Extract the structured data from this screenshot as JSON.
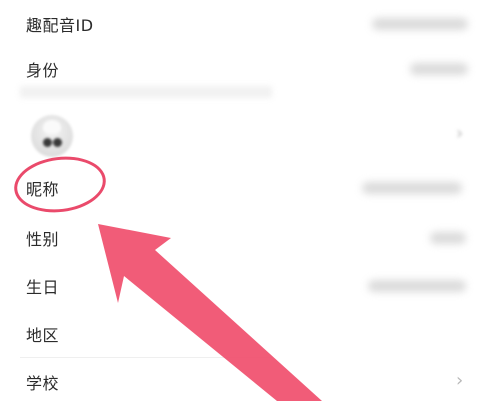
{
  "profile": {
    "qupeiyin_id": {
      "label": "趣配音ID"
    },
    "identity": {
      "label": "身份"
    },
    "avatar": {
      "icon": "avatar-icon"
    },
    "nickname": {
      "label": "昵称"
    },
    "gender": {
      "label": "性别"
    },
    "birthday": {
      "label": "生日"
    },
    "region": {
      "label": "地区"
    },
    "school": {
      "label": "学校",
      "chevron": "›"
    }
  },
  "annotation": {
    "color": "#ea4a6b",
    "circle_target": "nickname",
    "arrow_target": "nickname"
  }
}
